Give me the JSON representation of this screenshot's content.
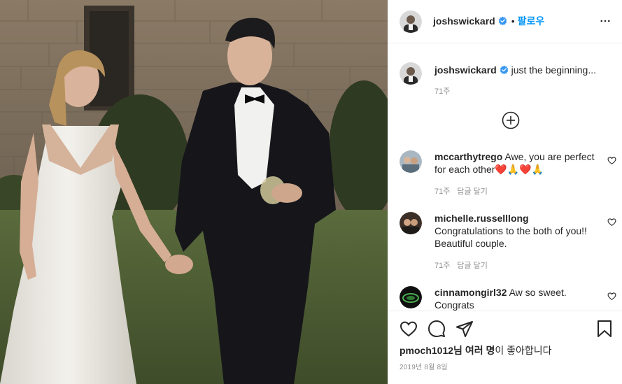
{
  "post": {
    "username": "joshswickard",
    "follow_label": "팔로우",
    "caption": "just the beginning...",
    "caption_time": "71주"
  },
  "comments": [
    {
      "username": "mccarthytrego",
      "text": "Awe, you are perfect for each other❤️🙏❤️🙏",
      "time": "71주",
      "reply_label": "답글 달기"
    },
    {
      "username": "michelle.russelllong",
      "text": "Congratulations to the both of you!! Beautiful couple.",
      "time": "71주",
      "reply_label": "답글 달기"
    },
    {
      "username": "cinnamongirl32",
      "text": "Aw so sweet. Congrats"
    }
  ],
  "likes": {
    "user": "pmoch1012",
    "suffix_bold": "님 여러 명",
    "suffix": "이 좋아합니다"
  },
  "date": "2019년 8월 8일",
  "icons": [
    "verified-badge-icon",
    "more-options-icon",
    "add-comment-icon",
    "heart-icon",
    "comment-icon",
    "share-icon",
    "bookmark-icon"
  ],
  "colors": {
    "link_blue": "#0095f6",
    "verified_blue": "#3897f0",
    "meta_gray": "#8e8e8e",
    "text": "#262626",
    "border": "#efefef"
  }
}
